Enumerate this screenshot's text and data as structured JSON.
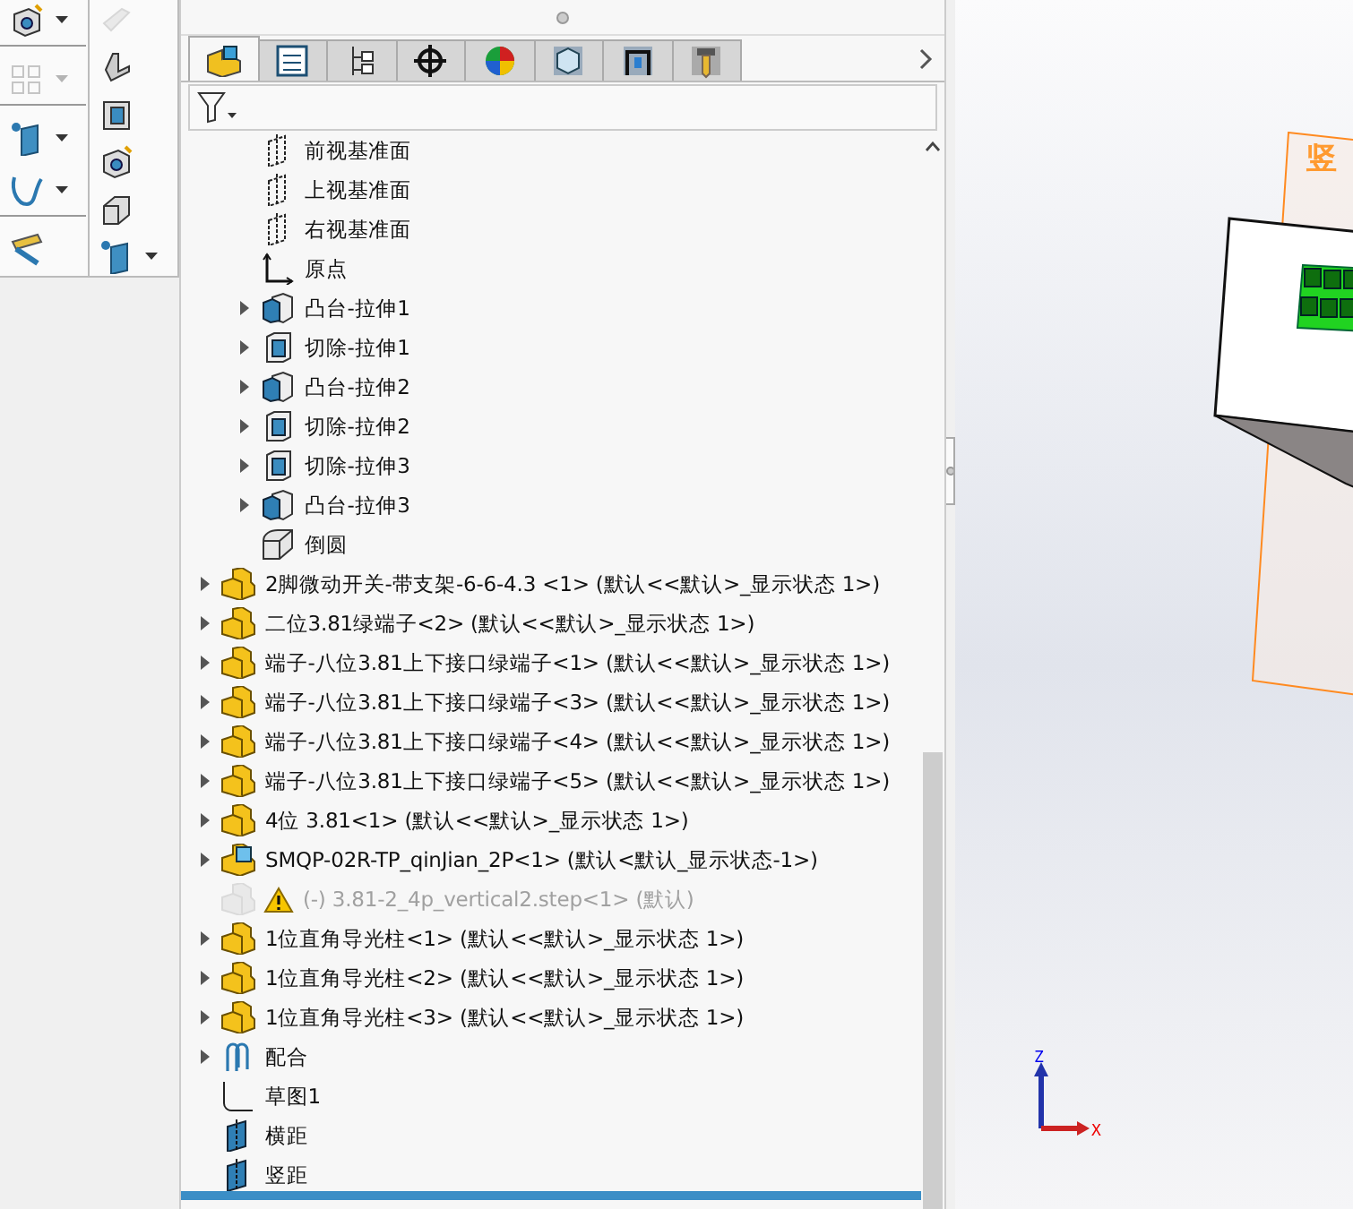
{
  "left_toolbar": [
    {
      "kind": "hole_wizard",
      "has_menu": true,
      "disabled": false
    },
    {
      "kind": "pattern",
      "has_menu": true,
      "disabled": true
    },
    {
      "kind": "ref_geometry",
      "has_menu": true,
      "disabled": false
    },
    {
      "kind": "curve",
      "has_menu": true,
      "disabled": false
    },
    {
      "kind": "measure",
      "has_menu": false,
      "disabled": false
    }
  ],
  "flyout_toolbar": [
    {
      "kind": "wedge",
      "has_menu": false,
      "disabled": true
    },
    {
      "kind": "rib",
      "has_menu": false,
      "disabled": false
    },
    {
      "kind": "shell",
      "has_menu": false,
      "disabled": false
    },
    {
      "kind": "hole_wizard",
      "has_menu": false,
      "disabled": false
    },
    {
      "kind": "fillet",
      "has_menu": false,
      "disabled": false
    },
    {
      "kind": "ref_geometry",
      "has_menu": true,
      "disabled": false
    }
  ],
  "tabs": [
    {
      "kind": "feature_tree",
      "selected": true
    },
    {
      "kind": "property",
      "selected": false
    },
    {
      "kind": "config",
      "selected": false
    },
    {
      "kind": "dimxpert",
      "selected": false
    },
    {
      "kind": "display",
      "selected": false
    },
    {
      "kind": "cam_part",
      "selected": false
    },
    {
      "kind": "cam_setup",
      "selected": false
    },
    {
      "kind": "cam_tool",
      "selected": false
    }
  ],
  "tree": {
    "part_features": [
      {
        "label": "前视基准面",
        "kind": "plane",
        "expandable": false
      },
      {
        "label": "上视基准面",
        "kind": "plane",
        "expandable": false
      },
      {
        "label": "右视基准面",
        "kind": "plane",
        "expandable": false
      },
      {
        "label": "原点",
        "kind": "origin",
        "expandable": false
      },
      {
        "label": "凸台-拉伸1",
        "kind": "boss",
        "expandable": true
      },
      {
        "label": "切除-拉伸1",
        "kind": "cut",
        "expandable": true
      },
      {
        "label": "凸台-拉伸2",
        "kind": "boss",
        "expandable": true
      },
      {
        "label": "切除-拉伸2",
        "kind": "cut",
        "expandable": true
      },
      {
        "label": "切除-拉伸3",
        "kind": "cut",
        "expandable": true
      },
      {
        "label": "凸台-拉伸3",
        "kind": "boss",
        "expandable": true
      },
      {
        "label": "倒圆",
        "kind": "fillet",
        "expandable": false
      }
    ],
    "items": [
      {
        "label": "2脚微动开关-带支架-6-6-4.3 <1> (默认<<默认>_显示状态 1>)",
        "kind": "part",
        "expandable": true,
        "suppressed": false,
        "warning": false
      },
      {
        "label": "二位3.81绿端子<2> (默认<<默认>_显示状态 1>)",
        "kind": "part",
        "expandable": true,
        "suppressed": false,
        "warning": false
      },
      {
        "label": "端子-八位3.81上下接口绿端子<1> (默认<<默认>_显示状态 1>)",
        "kind": "part",
        "expandable": true,
        "suppressed": false,
        "warning": false
      },
      {
        "label": "端子-八位3.81上下接口绿端子<3> (默认<<默认>_显示状态 1>)",
        "kind": "part",
        "expandable": true,
        "suppressed": false,
        "warning": false
      },
      {
        "label": "端子-八位3.81上下接口绿端子<4> (默认<<默认>_显示状态 1>)",
        "kind": "part",
        "expandable": true,
        "suppressed": false,
        "warning": false
      },
      {
        "label": "端子-八位3.81上下接口绿端子<5> (默认<<默认>_显示状态 1>)",
        "kind": "part",
        "expandable": true,
        "suppressed": false,
        "warning": false
      },
      {
        "label": "4位 3.81<1> (默认<<默认>_显示状态 1>)",
        "kind": "part",
        "expandable": true,
        "suppressed": false,
        "warning": false
      },
      {
        "label": "SMQP-02R-TP_qinJian_2P<1> (默认<默认_显示状态-1>)",
        "kind": "part_blue",
        "expandable": true,
        "suppressed": false,
        "warning": false
      },
      {
        "label": "(-) 3.81-2_4p_vertical2.step<1> (默认)",
        "kind": "part",
        "expandable": false,
        "suppressed": true,
        "warning": true
      },
      {
        "label": "1位直角导光柱<1> (默认<<默认>_显示状态 1>)",
        "kind": "part",
        "expandable": true,
        "suppressed": false,
        "warning": false
      },
      {
        "label": "1位直角导光柱<2> (默认<<默认>_显示状态 1>)",
        "kind": "part",
        "expandable": true,
        "suppressed": false,
        "warning": false
      },
      {
        "label": "1位直角导光柱<3> (默认<<默认>_显示状态 1>)",
        "kind": "part",
        "expandable": true,
        "suppressed": false,
        "warning": false
      },
      {
        "label": "配合",
        "kind": "mates",
        "expandable": true,
        "suppressed": false,
        "warning": false
      },
      {
        "label": "草图1",
        "kind": "sketch",
        "expandable": false,
        "suppressed": false,
        "warning": false
      },
      {
        "label": "横距",
        "kind": "ref_plane",
        "expandable": false,
        "suppressed": false,
        "warning": false
      },
      {
        "label": "竖距",
        "kind": "ref_plane",
        "expandable": false,
        "suppressed": false,
        "warning": false
      }
    ]
  },
  "viewport": {
    "plane_label": "竖",
    "axes": [
      {
        "label": "Z",
        "kind": "z"
      },
      {
        "label": "X",
        "kind": "x"
      }
    ]
  }
}
